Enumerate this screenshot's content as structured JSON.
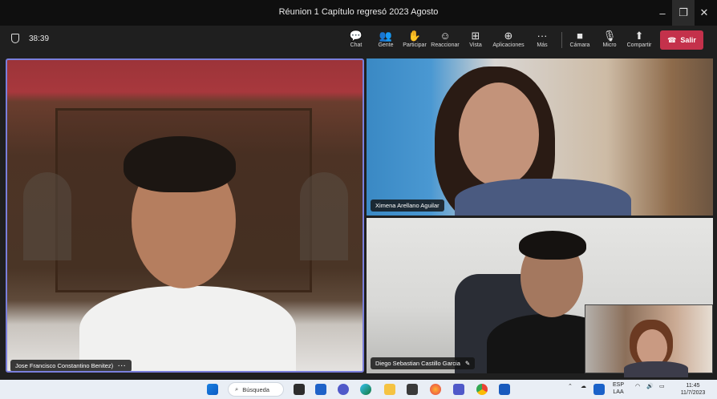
{
  "window": {
    "title": "Réunion 1 Capítulo regresó 2023 Agosto",
    "controls": {
      "minimize": "–",
      "maximize": "❐",
      "close": "✕"
    }
  },
  "toolbar": {
    "timer": "38:39",
    "buttons": [
      {
        "label": "Chat",
        "icon": "chat-icon",
        "glyph": "💬"
      },
      {
        "label": "Gente",
        "icon": "people-icon",
        "glyph": "👥"
      },
      {
        "label": "Participar",
        "icon": "raise-hand-icon",
        "glyph": "✋"
      },
      {
        "label": "Reaccionar",
        "icon": "smile-icon",
        "glyph": "☺"
      },
      {
        "label": "Vista",
        "icon": "view-grid-icon",
        "glyph": "⊞"
      },
      {
        "label": "Aplicaciones",
        "icon": "apps-plus-icon",
        "glyph": "⊕"
      },
      {
        "label": "Más",
        "icon": "more-icon",
        "glyph": "···"
      }
    ],
    "media": [
      {
        "label": "Cámara",
        "icon": "camera-icon",
        "glyph": "■"
      },
      {
        "label": "Micro",
        "icon": "microphone-icon",
        "glyph": "🎙"
      },
      {
        "label": "Compartir",
        "icon": "share-icon",
        "glyph": "⬆"
      }
    ],
    "leave_label": "Salir",
    "leave_color": "#c4314b"
  },
  "participants": {
    "main": {
      "name": "Jose Francisco Constantino Benitez)",
      "more": "···"
    },
    "top_right": {
      "name": "Ximena Arellano Aguilar"
    },
    "bottom_right": {
      "name": "Diego Sebastian Castillo Garcia",
      "mic_icon": "mic-off-icon"
    }
  },
  "taskbar": {
    "search_label": "Búsqueda",
    "language_top": "ESP",
    "language_bottom": "LAA",
    "time": "11:45",
    "date": "11/7/2023",
    "apps": [
      "windows-start-icon",
      "file-explorer-icon",
      "widgets-icon",
      "teams-icon",
      "edge-icon",
      "folder-icon",
      "store-icon",
      "firefox-icon",
      "teams-notification-icon",
      "chrome-icon",
      "word-icon"
    ]
  },
  "colors": {
    "accent_border": "#7a7fdc",
    "leave": "#c4314b",
    "titlebar": "#0f0f0f",
    "toolbar": "#1f1f1f"
  }
}
